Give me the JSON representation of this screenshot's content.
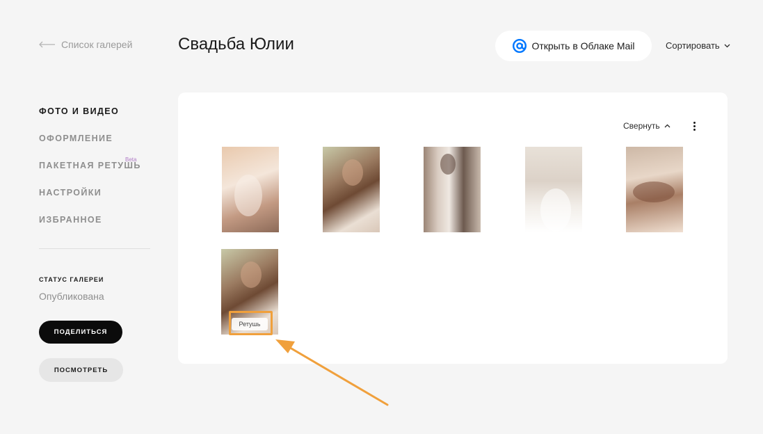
{
  "header": {
    "back_label": "Список галерей",
    "title": "Свадьба Юлии",
    "cloud_button_label": "Открыть в Облаке Mail",
    "sort_label": "Сортировать"
  },
  "sidebar": {
    "items": [
      {
        "label": "ФОТО И ВИДЕО",
        "active": true
      },
      {
        "label": "ОФОРМЛЕНИЕ",
        "active": false
      },
      {
        "label": "ПАКЕТНАЯ РЕТУШЬ",
        "active": false,
        "badge": "Beta"
      },
      {
        "label": "НАСТРОЙКИ",
        "active": false
      },
      {
        "label": "ИЗБРАННОЕ",
        "active": false
      }
    ],
    "status_label": "СТАТУС ГАЛЕРЕИ",
    "status_value": "Опубликована",
    "share_label": "ПОДЕЛИТЬСЯ",
    "view_label": "ПОСМОТРЕТЬ"
  },
  "panel": {
    "collapse_label": "Свернуть",
    "retouch_badge": "Ретушь"
  },
  "colors": {
    "background": "#f5f5f5",
    "accent_mail": "#0077ff",
    "annotation": "#f0a03c",
    "beta": "#b07cc6"
  },
  "icons": [
    "arrow-left-icon",
    "mail-at-icon",
    "chevron-down-icon",
    "chevron-up-icon",
    "more-vertical-icon"
  ]
}
